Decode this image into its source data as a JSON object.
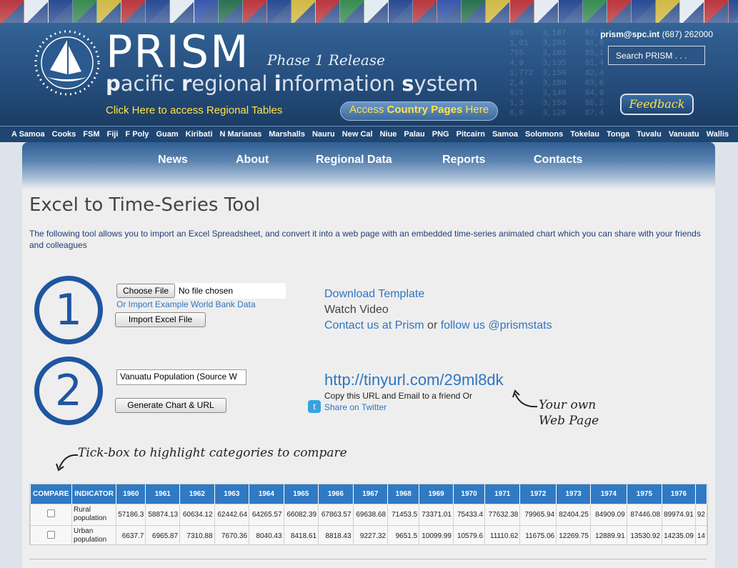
{
  "header": {
    "brand": "PRISM",
    "release": "Phase 1 Release",
    "tagline_parts": [
      "p",
      "acific ",
      "r",
      "egional ",
      "i",
      "nformation ",
      "s",
      "ystem"
    ],
    "regional_link": "Click Here to access Regional Tables",
    "country_pages": {
      "prefix": "Access ",
      "bold": "Country Pages",
      "suffix": " Here"
    },
    "email": "prism@spc.int",
    "phone": " (687) 262000",
    "search_placeholder": "Search PRISM . . .",
    "feedback": "Feedback"
  },
  "countries": [
    "A Samoa",
    "Cooks",
    "FSM",
    "Fiji",
    "F Poly",
    "Guam",
    "Kiribati",
    "N Marianas",
    "Marshalls",
    "Nauru",
    "New Cal",
    "Niue",
    "Palau",
    "PNG",
    "Pitcairn",
    "Samoa",
    "Solomons",
    "Tokelau",
    "Tonga",
    "Tuvalu",
    "Vanuatu",
    "Wallis"
  ],
  "nav": [
    "News",
    "About",
    "Regional Data",
    "Reports",
    "Contacts"
  ],
  "page": {
    "title": "Excel to Time-Series Tool",
    "intro": "The following tool allows you to import an Excel Spreadsheet, and convert it into a web page with an embedded time-series animated chart which you can share with your friends and colleagues"
  },
  "step1": {
    "number": "1",
    "choose_file": "Choose File",
    "no_file": "No file chosen",
    "example_link": "Or Import Example World Bank Data",
    "import_button": "Import Excel File",
    "download_template": "Download Template",
    "watch_video": "Watch Video",
    "contact_link": "Contact us at Prism",
    "or": " or ",
    "follow_link": "follow us @prismstats"
  },
  "step2": {
    "number": "2",
    "title_value": "Vanuatu Population (Source W",
    "generate_button": "Generate Chart & URL",
    "url": "http://tinyurl.com/29ml8dk",
    "copy_text": "Copy this URL and Email to a friend Or",
    "twitter_link": "Share on Twitter",
    "note_line1": "Your own",
    "note_line2": "Web Page"
  },
  "tick_note": "Tick-box to highlight categories to compare",
  "table": {
    "headers": [
      "COMPARE",
      "INDICATOR",
      "1960",
      "1961",
      "1962",
      "1963",
      "1964",
      "1965",
      "1966",
      "1967",
      "1968",
      "1969",
      "1970",
      "1971",
      "1972",
      "1973",
      "1974",
      "1975",
      "1976"
    ],
    "rows": [
      {
        "indicator": "Rural population",
        "values": [
          "57186.3",
          "58874.13",
          "60634.12",
          "62442.64",
          "64265.57",
          "66082.39",
          "67863.57",
          "69638.68",
          "71453.5",
          "73371.01",
          "75433.4",
          "77632.38",
          "79965.94",
          "82404.25",
          "84909.09",
          "87446.08",
          "89974.91",
          "92"
        ]
      },
      {
        "indicator": "Urban population",
        "values": [
          "6637.7",
          "6965.87",
          "7310.88",
          "7670.36",
          "8040.43",
          "8418.61",
          "8818.43",
          "9227.32",
          "9651.5",
          "10099.99",
          "10579.6",
          "11110.62",
          "11675.06",
          "12269.75",
          "12889.91",
          "13530.92",
          "14235.09",
          "14"
        ]
      }
    ]
  }
}
